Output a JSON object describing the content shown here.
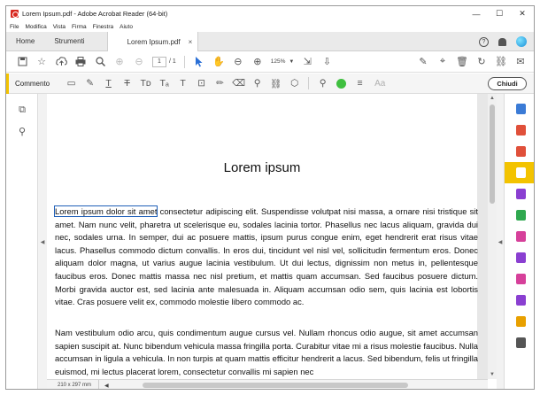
{
  "window": {
    "title": "Lorem Ipsum.pdf - Adobe Acrobat Reader (64-bit)",
    "controls": {
      "minimize": "—",
      "maximize": "☐",
      "close": "✕"
    }
  },
  "menubar": [
    "File",
    "Modifica",
    "Vista",
    "Firma",
    "Finestra",
    "Aiuto"
  ],
  "tabs": {
    "home": "Home",
    "tools": "Strumenti",
    "document": "Lorem Ipsum.pdf",
    "close_glyph": "×"
  },
  "tabbar_right": {
    "help": "?"
  },
  "toolbar": {
    "page_current": "1",
    "page_total": "/ 1",
    "zoom": "125%"
  },
  "comment_bar": {
    "label": "Commento",
    "font_glyph": "Aa",
    "close_label": "Chiudi",
    "accent_color": "#f3c300",
    "color_swatch": "#3fbf3f"
  },
  "document": {
    "title": "Lorem ipsum",
    "highlighted": "Lorem ipsum dolor sit amet",
    "para1_rest": " consectetur adipiscing elit. Suspendisse volutpat nisi massa, a ornare nisi tristique sit amet. Nam nunc velit, pharetra ut scelerisque eu, sodales lacinia tortor. Phasellus nec lacus aliquam, gravida dui nec, sodales urna. In semper, dui ac posuere mattis, ipsum purus congue enim, eget hendrerit erat risus vitae lacus. Phasellus commodo dictum convallis. In eros dui, tincidunt vel nisl vel, sollicitudin fermentum eros. Donec aliquam dolor magna, ut varius augue lacinia vestibulum. Ut dui lectus, dignissim non metus in, pellentesque faucibus eros. Donec mattis massa nec nisl pretium, et mattis quam accumsan. Sed faucibus posuere dictum. Morbi gravida auctor est, sed lacinia ante malesuada in. Aliquam accumsan odio sem, quis lacinia est lobortis vitae. Cras posuere velit ex, commodo molestie libero commodo ac.",
    "para2": "Nam vestibulum odio arcu, quis condimentum augue cursus vel. Nullam rhoncus odio augue, sit amet accumsan sapien suscipit at. Nunc bibendum vehicula massa fringilla porta. Curabitur vitae mi a risus molestie faucibus. Nulla accumsan in ligula a vehicula. In non turpis at quam mattis efficitur hendrerit a lacus. Sed bibendum, felis ut fringilla euismod, mi lectus placerat lorem, consectetur convallis mi sapien nec"
  },
  "statusbar": {
    "page_size": "210 x 297 mm"
  },
  "icon_colors": {
    "export_pdf": "#3b7bd6",
    "organize": "#e0503a",
    "create_pdf": "#e0503a",
    "comment": "#f3c300",
    "combine": "#8a3fd1",
    "edit": "#2fa84f",
    "compress": "#d6409a",
    "fill_sign": "#8a3fd1",
    "protect": "#d6409a",
    "share": "#8a3fd1",
    "stamp": "#e8a000",
    "more_tools": "#555555"
  }
}
